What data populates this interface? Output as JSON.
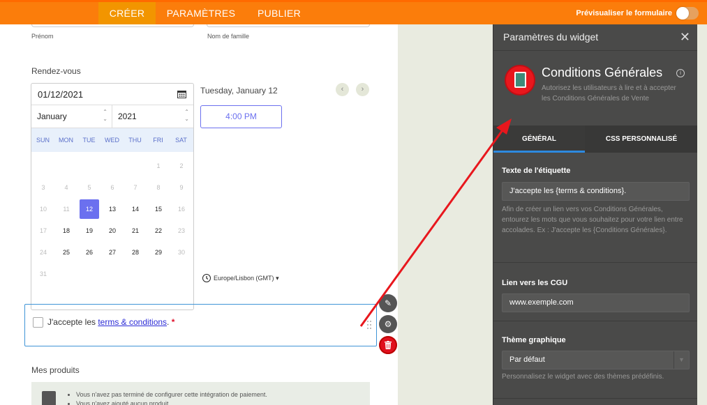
{
  "topbar": {
    "tabs": [
      "CRÉER",
      "PARAMÈTRES",
      "PUBLIER"
    ],
    "active_tab": "CRÉER",
    "preview_label": "Prévisualiser le formulaire",
    "accent": "#fb7d0b"
  },
  "form": {
    "name_sublabels": [
      "Prénom",
      "Nom de famille"
    ],
    "appointment": {
      "label": "Rendez-vous",
      "date_value": "01/12/2021",
      "month": "January",
      "year": "2021",
      "weekdays": [
        "SUN",
        "MON",
        "TUE",
        "WED",
        "THU",
        "FRI",
        "SAT"
      ],
      "weeks": [
        [
          "",
          "",
          "",
          "",
          "",
          "1",
          "2"
        ],
        [
          "3",
          "4",
          "5",
          "6",
          "7",
          "8",
          "9"
        ],
        [
          "10",
          "11",
          "12",
          "13",
          "14",
          "15",
          "16"
        ],
        [
          "17",
          "18",
          "19",
          "20",
          "21",
          "22",
          "23"
        ],
        [
          "24",
          "25",
          "26",
          "27",
          "28",
          "29",
          "30"
        ],
        [
          "31",
          "",
          "",
          "",
          "",
          "",
          ""
        ]
      ],
      "selected_day": "12",
      "slot_date": "Tuesday, January 12",
      "slot_time": "4:00 PM",
      "timezone": "Europe/Lisbon (GMT)",
      "prev_icon": "chevron-left-icon",
      "next_icon": "chevron-right-icon"
    },
    "terms": {
      "prefix": "J'accepte les ",
      "link": "terms & conditions",
      "suffix": ".",
      "required_mark": "*"
    },
    "tools": [
      "wand-icon",
      "gear-icon",
      "trash-icon"
    ],
    "products": {
      "label": "Mes produits",
      "notes": [
        "Vous n'avez pas terminé de configurer cette intégration de paiement.",
        "Vous n'avez ajouté aucun produit."
      ]
    }
  },
  "panel": {
    "title": "Paramètres du widget",
    "widget_name": "Conditions Générales",
    "widget_desc": "Autorisez les utilisateurs à lire et à accepter les Conditions Générales de Vente",
    "tabs": [
      "GÉNÉRAL",
      "CSS PERSONNALISÉ"
    ],
    "active_tab": "GÉNÉRAL",
    "label_section": {
      "title": "Texte de l'étiquette",
      "value": "J'accepte les {terms & conditions}.",
      "hint": "Afin de créer un lien vers vos Conditions Générales, entourez les mots que vous souhaitez pour votre lien entre accolades. Ex : J'accepte les {Conditions Générales}."
    },
    "link_section": {
      "title": "Lien vers les CGU",
      "value": "www.exemple.com"
    },
    "theme_section": {
      "title": "Thème graphique",
      "value": "Par défaut",
      "hint": "Personnalisez le widget avec des thèmes prédéfinis."
    },
    "arrow_color": "#e8171d"
  }
}
